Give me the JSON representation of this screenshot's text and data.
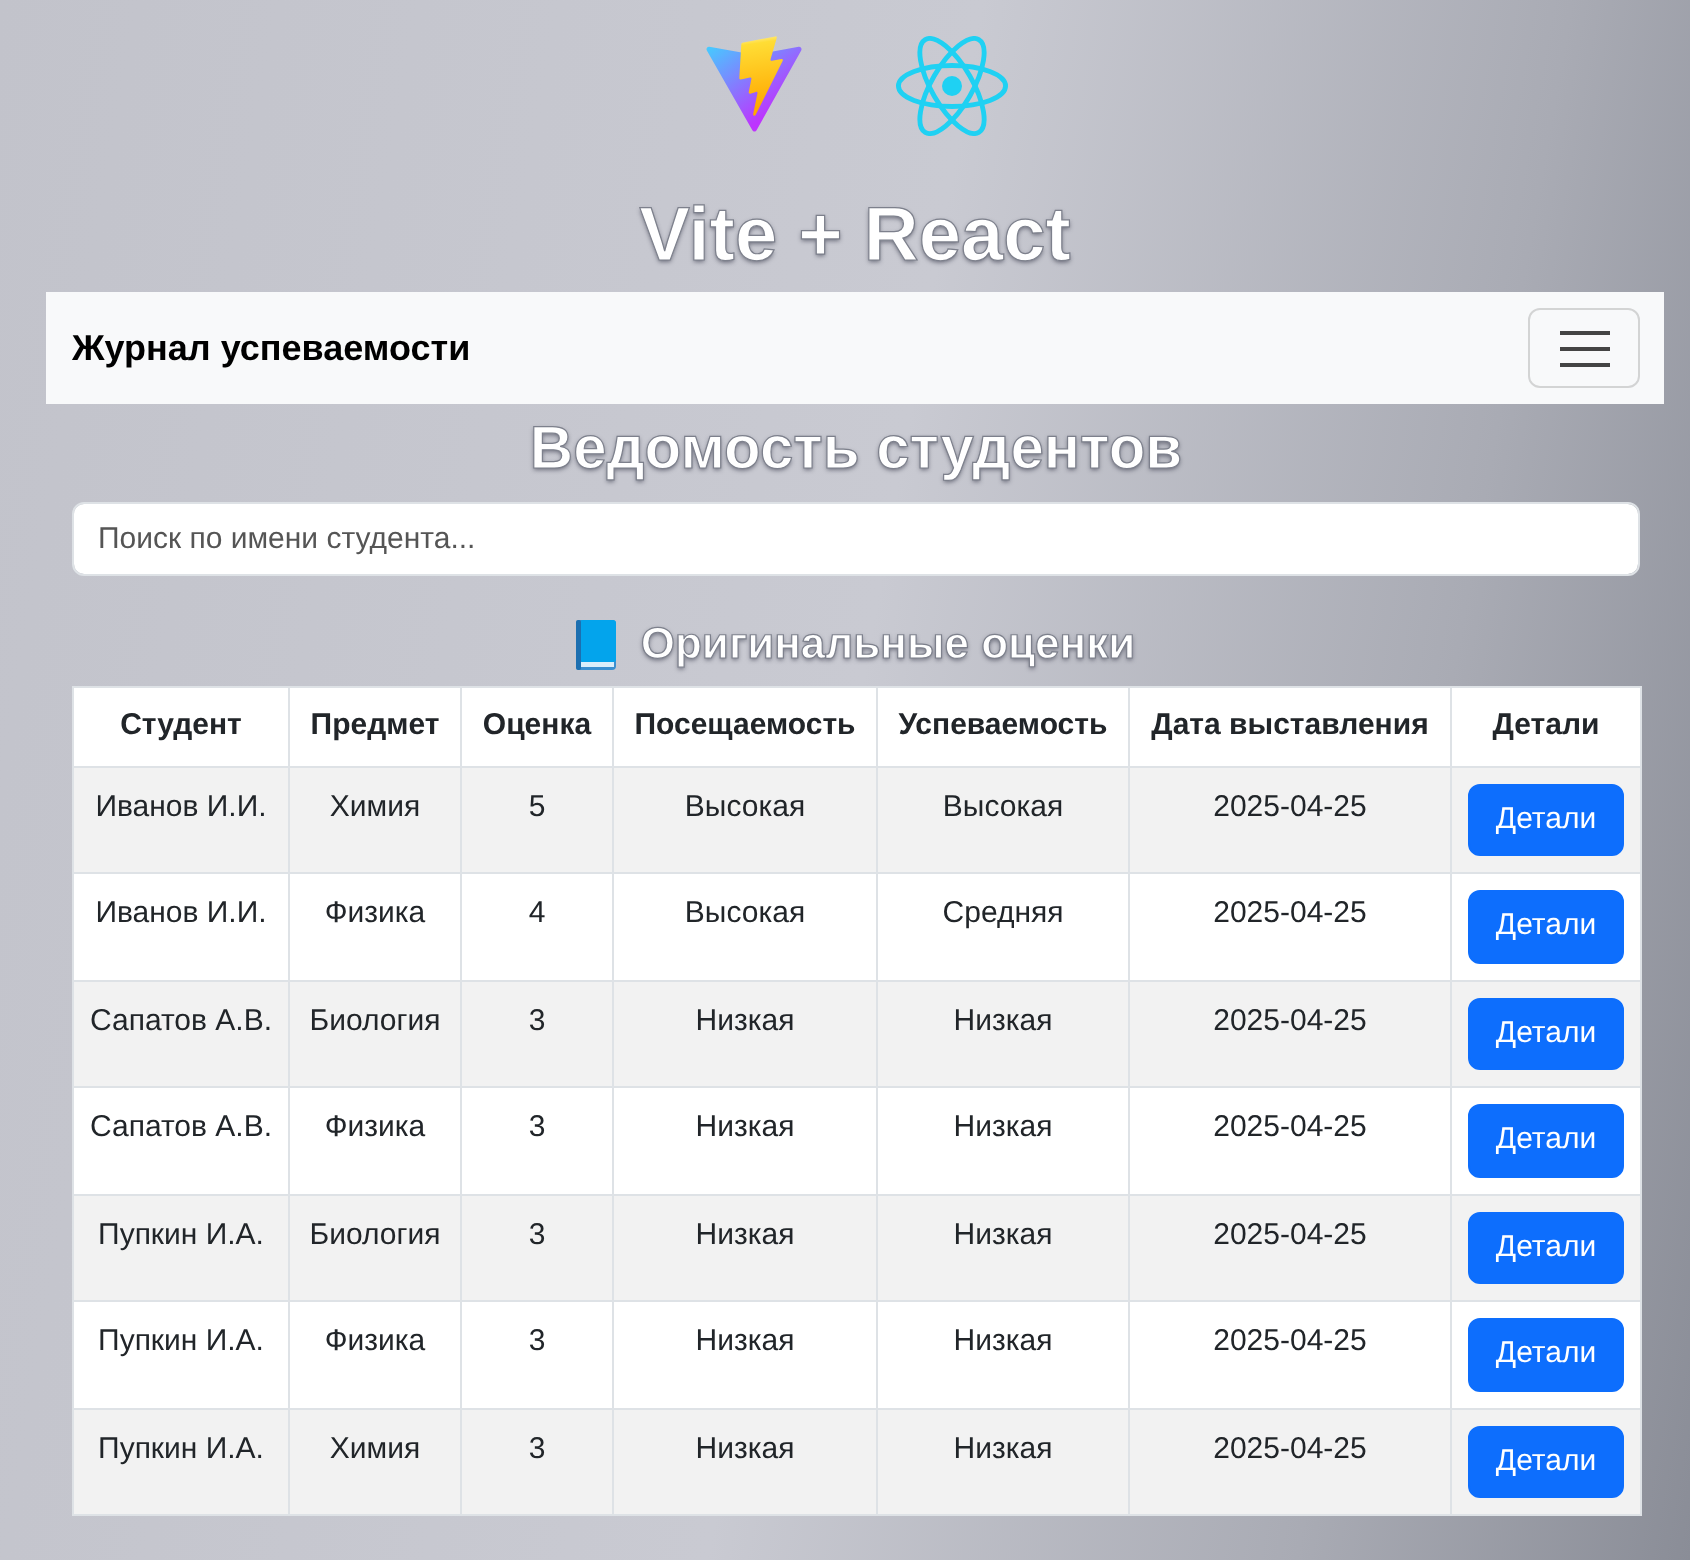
{
  "header": {
    "title": "Vite + React"
  },
  "navbar": {
    "brand": "Журнал успеваемости"
  },
  "page_title": "Ведомость студентов",
  "search": {
    "placeholder": "Поиск по имени студента..."
  },
  "section": {
    "title": "Оригинальные оценки"
  },
  "table": {
    "columns": [
      "Студент",
      "Предмет",
      "Оценка",
      "Посещаемость",
      "Успеваемость",
      "Дата выставления",
      "Детали"
    ],
    "rows": [
      {
        "cells": [
          "Иванов И.И.",
          "Химия",
          "5",
          "Высокая",
          "Высокая",
          "2025-04-25"
        ],
        "button": "Детали"
      },
      {
        "cells": [
          "Иванов И.И.",
          "Физика",
          "4",
          "Высокая",
          "Средняя",
          "2025-04-25"
        ],
        "button": "Детали"
      },
      {
        "cells": [
          "Сапатов А.В.",
          "Биология",
          "3",
          "Низкая",
          "Низкая",
          "2025-04-25"
        ],
        "button": "Детали"
      },
      {
        "cells": [
          "Сапатов А.В.",
          "Физика",
          "3",
          "Низкая",
          "Низкая",
          "2025-04-25"
        ],
        "button": "Детали"
      },
      {
        "cells": [
          "Пупкин И.А.",
          "Биология",
          "3",
          "Низкая",
          "Низкая",
          "2025-04-25"
        ],
        "button": "Детали"
      },
      {
        "cells": [
          "Пупкин И.А.",
          "Физика",
          "3",
          "Низкая",
          "Низкая",
          "2025-04-25"
        ],
        "button": "Детали"
      },
      {
        "cells": [
          "Пупкин И.А.",
          "Химия",
          "3",
          "Низкая",
          "Низкая",
          "2025-04-25"
        ],
        "button": "Детали"
      }
    ]
  }
}
